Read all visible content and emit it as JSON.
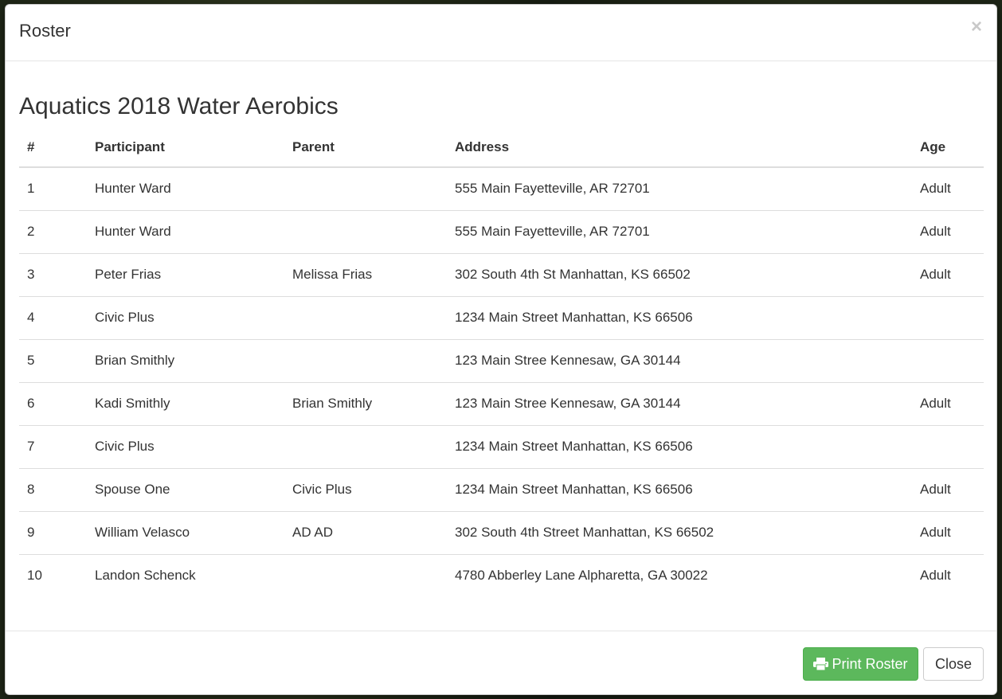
{
  "modal": {
    "title": "Roster",
    "close_symbol": "×"
  },
  "roster": {
    "heading": "Aquatics 2018 Water Aerobics",
    "columns": [
      "#",
      "Participant",
      "Parent",
      "Address",
      "Age"
    ],
    "rows": [
      {
        "num": "1",
        "participant": "Hunter Ward",
        "parent": "",
        "address": "555 Main Fayetteville, AR 72701",
        "age": "Adult"
      },
      {
        "num": "2",
        "participant": "Hunter Ward",
        "parent": "",
        "address": "555 Main Fayetteville, AR 72701",
        "age": "Adult"
      },
      {
        "num": "3",
        "participant": "Peter Frias",
        "parent": "Melissa Frias",
        "address": "302 South 4th St Manhattan, KS 66502",
        "age": "Adult"
      },
      {
        "num": "4",
        "participant": "Civic Plus",
        "parent": "",
        "address": "1234 Main Street Manhattan, KS 66506",
        "age": ""
      },
      {
        "num": "5",
        "participant": "Brian Smithly",
        "parent": "",
        "address": "123 Main Stree Kennesaw, GA 30144",
        "age": ""
      },
      {
        "num": "6",
        "participant": "Kadi Smithly",
        "parent": "Brian Smithly",
        "address": "123 Main Stree Kennesaw, GA 30144",
        "age": "Adult"
      },
      {
        "num": "7",
        "participant": "Civic Plus",
        "parent": "",
        "address": "1234 Main Street Manhattan, KS 66506",
        "age": ""
      },
      {
        "num": "8",
        "participant": "Spouse One",
        "parent": "Civic Plus",
        "address": "1234 Main Street Manhattan, KS 66506",
        "age": "Adult"
      },
      {
        "num": "9",
        "participant": "William Velasco",
        "parent": "AD AD",
        "address": "302 South 4th Street Manhattan, KS 66502",
        "age": "Adult"
      },
      {
        "num": "10",
        "participant": "Landon Schenck",
        "parent": "",
        "address": "4780 Abberley Lane Alpharetta, GA 30022",
        "age": "Adult"
      }
    ]
  },
  "footer": {
    "print_label": "Print Roster",
    "print_icon": "printer-icon",
    "close_label": "Close"
  },
  "colors": {
    "print_button": "#5cb85c",
    "text": "#333333",
    "border": "#dddddd"
  }
}
